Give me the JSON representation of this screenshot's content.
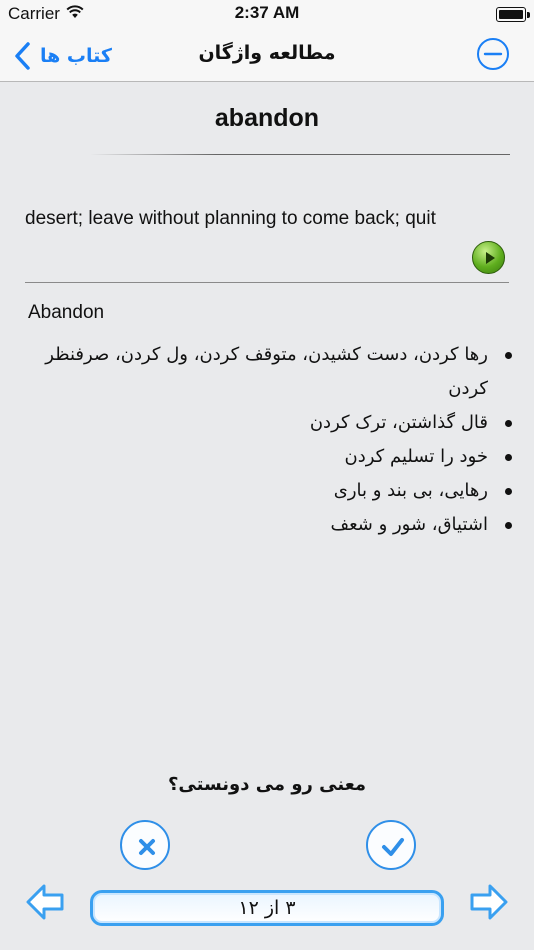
{
  "status_bar": {
    "carrier": "Carrier",
    "time": "2:37 AM"
  },
  "nav": {
    "back_label": "کتاب ها",
    "title": "مطالعه واژگان"
  },
  "word": {
    "title": "abandon",
    "definition": "desert; leave without planning to come back; quit",
    "english": "Abandon",
    "meanings": [
      "رها کردن، دست کشیدن، متوقف کردن، ول کردن، صرفنظر کردن",
      "قال گذاشتن، ترک کردن",
      "خود را تسلیم کردن",
      "رهایی، بی بند و باری",
      "اشتیاق، شور و شعف"
    ]
  },
  "quiz": {
    "question": "معنی رو می دونستی؟"
  },
  "pager": {
    "counter": "۳ از ۱۲"
  },
  "colors": {
    "accent": "#1a7ff5",
    "play": "#5fae1e"
  },
  "icons": {
    "back": "chevron-left-icon",
    "minus": "minus-circle-icon",
    "play": "play-icon",
    "no": "x-icon",
    "yes": "check-icon",
    "prev": "arrow-left-icon",
    "next": "arrow-right-icon"
  }
}
